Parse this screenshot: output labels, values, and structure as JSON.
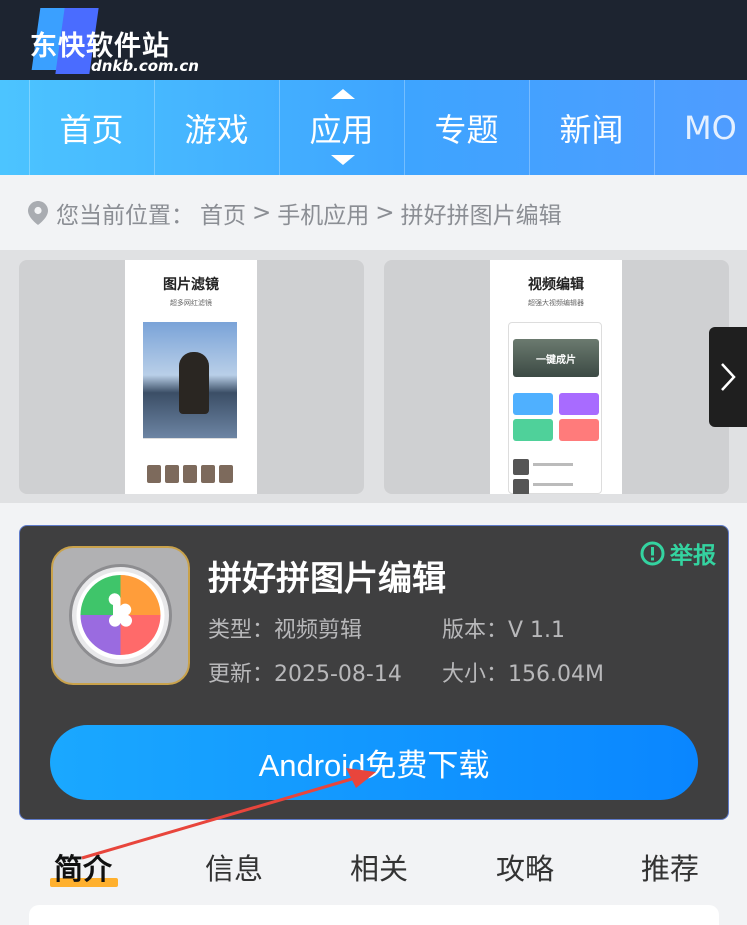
{
  "header": {
    "logo_text": "东快软件站",
    "logo_url": "dnkb.com.cn"
  },
  "nav": {
    "items": [
      {
        "label": "首页"
      },
      {
        "label": "游戏"
      },
      {
        "label": "应用",
        "active": true
      },
      {
        "label": "专题"
      },
      {
        "label": "新闻"
      },
      {
        "label": "MO"
      }
    ]
  },
  "breadcrumb": {
    "prefix": "您当前位置：",
    "items": [
      "首页",
      ">",
      "手机应用",
      ">",
      "拼好拼图片编辑"
    ]
  },
  "screenshots": {
    "items": [
      {
        "title": "图片滤镜",
        "subtitle": "超多网红滤镜"
      },
      {
        "title": "视频编辑",
        "subtitle": "超强大视频编辑器",
        "banner": "一键成片"
      }
    ]
  },
  "app": {
    "name": "拼好拼图片编辑",
    "report_label": "举报",
    "type_label": "类型：视频剪辑",
    "version_label": "版本：V 1.1",
    "update_label": "更新：2025-08-14",
    "size_label": "大小：156.04M",
    "download_label": "Android免费下载",
    "icon_colors": [
      "#3fc56a",
      "#ff9d3a",
      "#9a6be0",
      "#ff6a6a"
    ]
  },
  "tabs": {
    "items": [
      {
        "label": "简介",
        "active": true
      },
      {
        "label": "信息"
      },
      {
        "label": "相关"
      },
      {
        "label": "攻略"
      },
      {
        "label": "推荐"
      }
    ]
  },
  "colors": {
    "accent": "#1aa8ff",
    "report": "#34d3a0",
    "tab_underline": "#ffb02e",
    "annotation_arrow": "#e8453c"
  }
}
